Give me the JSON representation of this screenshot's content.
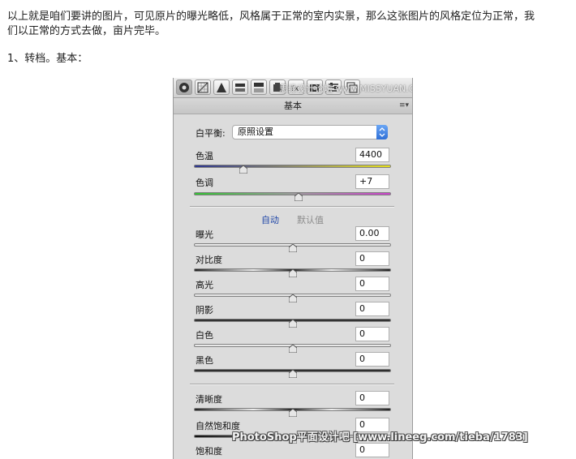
{
  "article": {
    "paragraph_line1": "以上就是咱们要讲的图片，可见原片的曝光略低，风格属于正常的室内实景，那么这张图片的风格定位为正常，我",
    "paragraph_line2": "们以正常的方式去做，亩片完毕。",
    "step": "1、转档。基本："
  },
  "panel": {
    "watermark_top": "思缘设计论坛 www.MISSYUAN.COM",
    "header": "基本",
    "menu_icon": "≡▾",
    "white_balance": {
      "label": "白平衡:",
      "value": "原照设置"
    },
    "temperature": {
      "label": "色温",
      "value": "4400",
      "position": 0.25
    },
    "tint": {
      "label": "色调",
      "value": "+7",
      "position": 0.53
    },
    "auto_label": "自动",
    "default_label": "默认值",
    "sliders": [
      {
        "label": "曝光",
        "value": "0.00",
        "position": 0.5
      },
      {
        "label": "对比度",
        "value": "0",
        "position": 0.5
      },
      {
        "label": "高光",
        "value": "0",
        "position": 0.5
      },
      {
        "label": "阴影",
        "value": "0",
        "position": 0.5
      },
      {
        "label": "白色",
        "value": "0",
        "position": 0.5
      },
      {
        "label": "黑色",
        "value": "0",
        "position": 0.5
      }
    ],
    "presence": [
      {
        "label": "清晰度",
        "value": "0",
        "position": 0.5
      },
      {
        "label": "自然饱和度",
        "value": "0",
        "position": 0.5
      },
      {
        "label": "饱和度",
        "value": "0",
        "position": 0.5
      }
    ]
  },
  "watermark_bottom": "PhotoShop平面设计吧 [www.lineeg.com/tieba/1783]"
}
